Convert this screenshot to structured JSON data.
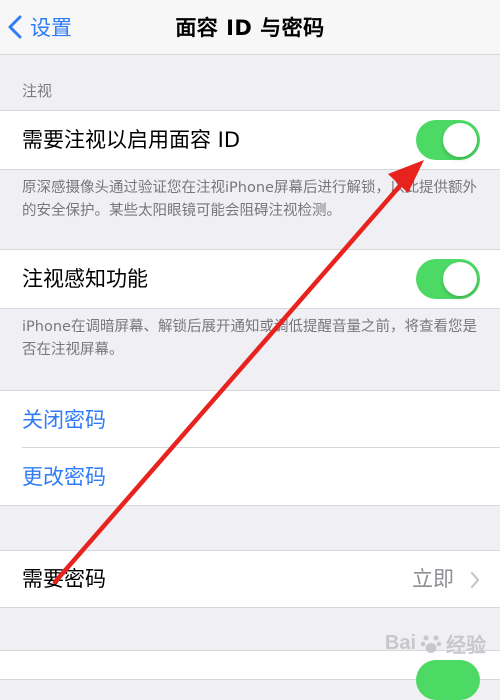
{
  "navbar": {
    "back_label": "设置",
    "title": "面容 ID 与密码"
  },
  "attention": {
    "section_header": "注视",
    "require_attention_label": "需要注视以启用面容 ID",
    "require_attention_on": true,
    "require_attention_footer": "原深感摄像头通过验证您在注视iPhone屏幕后进行解锁，以此提供额外的安全保护。某些太阳眼镜可能会阻碍注视检测。",
    "attention_aware_label": "注视感知功能",
    "attention_aware_on": true,
    "attention_aware_footer": "iPhone在调暗屏幕、解锁后展开通知或调低提醒音量之前，将查看您是否在注视屏幕。"
  },
  "passcode": {
    "turn_off_label": "关闭密码",
    "change_label": "更改密码",
    "require_label": "需要密码",
    "require_value": "立即"
  },
  "watermark": {
    "text_left": "Bai",
    "text_right": "经验"
  },
  "annotation": {
    "color": "#e8231e"
  }
}
